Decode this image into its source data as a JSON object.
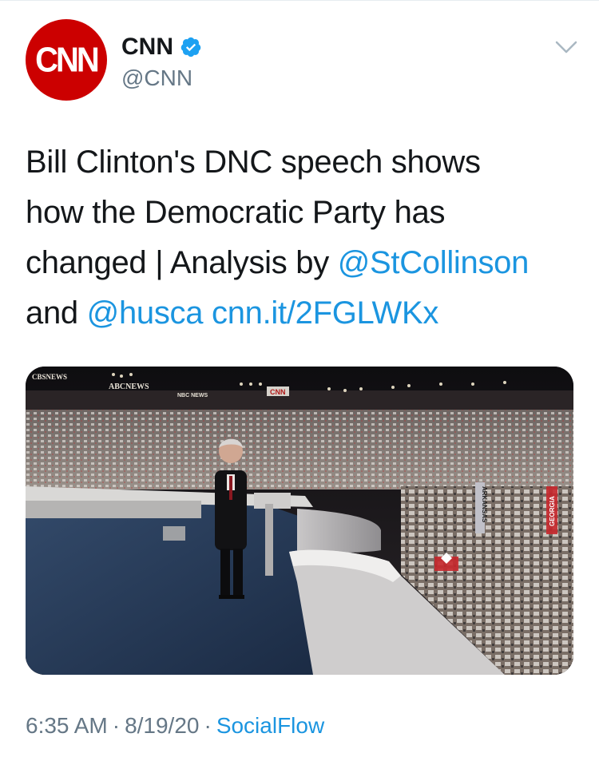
{
  "author": {
    "name": "CNN",
    "handle": "@CNN",
    "avatar_logo": "CNN",
    "verified": true,
    "verified_icon": "verified-badge-icon",
    "brand_color": "#cc0000"
  },
  "tweet": {
    "text_parts": {
      "line1": "Bill Clinton's DNC speech shows",
      "line2": "how the Democratic Party has",
      "line3_text": "changed | Analysis by ",
      "mention1": "@StCollinson",
      "line4_text": "and ",
      "mention2": "@husca",
      "space": " ",
      "url": "cnn.it/2FGLWKx"
    },
    "link_color": "#1b95e0"
  },
  "media": {
    "signs": {
      "cbs": "CBSNEWS",
      "abc": "ABCNEWS",
      "nbc": "NBC NEWS",
      "cnn": "CNN",
      "arkansas": "ARKANSAS",
      "georgia": "GEORGIA"
    }
  },
  "meta": {
    "time": "6:35 AM",
    "separator": "·",
    "date": "8/19/20",
    "source": "SocialFlow"
  },
  "icons": {
    "caret": "chevron-down-icon"
  }
}
